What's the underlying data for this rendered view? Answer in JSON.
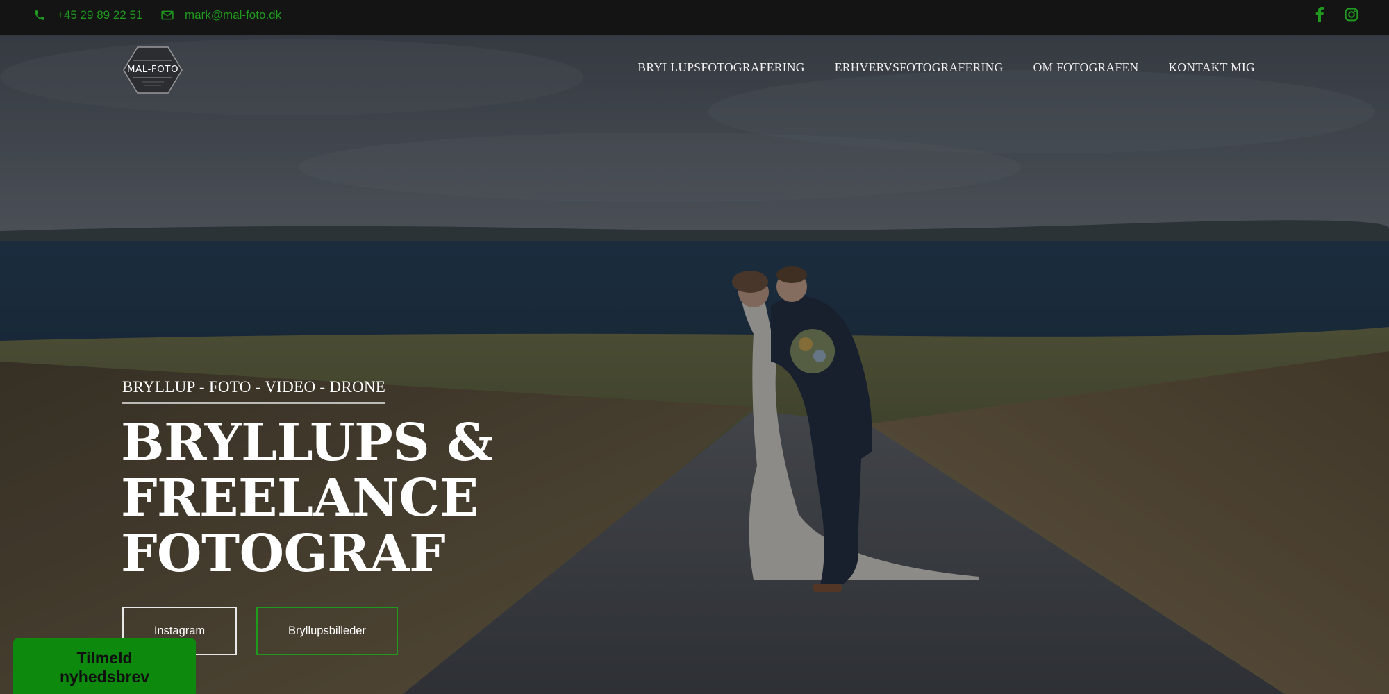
{
  "topbar": {
    "phone": "+45 29 89 22 51",
    "email": "mark@mal-foto.dk",
    "icons": {
      "phone": "phone-icon",
      "email": "envelope-icon",
      "facebook": "facebook-icon",
      "instagram": "instagram-icon"
    }
  },
  "logo": {
    "text": "MAL-FOTO",
    "script_text": "fotograf"
  },
  "nav": {
    "items": [
      {
        "label": "BRYLLUPSFOTOGRAFERING"
      },
      {
        "label": "ERHVERVSFOTOGRAFERING"
      },
      {
        "label": "OM FOTOGRAFEN"
      },
      {
        "label": "KONTAKT MIG"
      }
    ]
  },
  "hero": {
    "tagline": "BRYLLUP - FOTO - VIDEO - DRONE",
    "headline_lines": [
      "BRYLLUPS &",
      "FREELANCE",
      "FOTOGRAF"
    ],
    "buttons": {
      "instagram": "Instagram",
      "bryllupsbilleder": "Bryllupsbilleder"
    }
  },
  "newsletter": {
    "line1": "Tilmeld",
    "line2": "nyhedsbrev"
  },
  "colors": {
    "accent_green": "#1f9a1f",
    "newsletter_green": "#0d8a0d",
    "topbar_bg": "#141414"
  }
}
